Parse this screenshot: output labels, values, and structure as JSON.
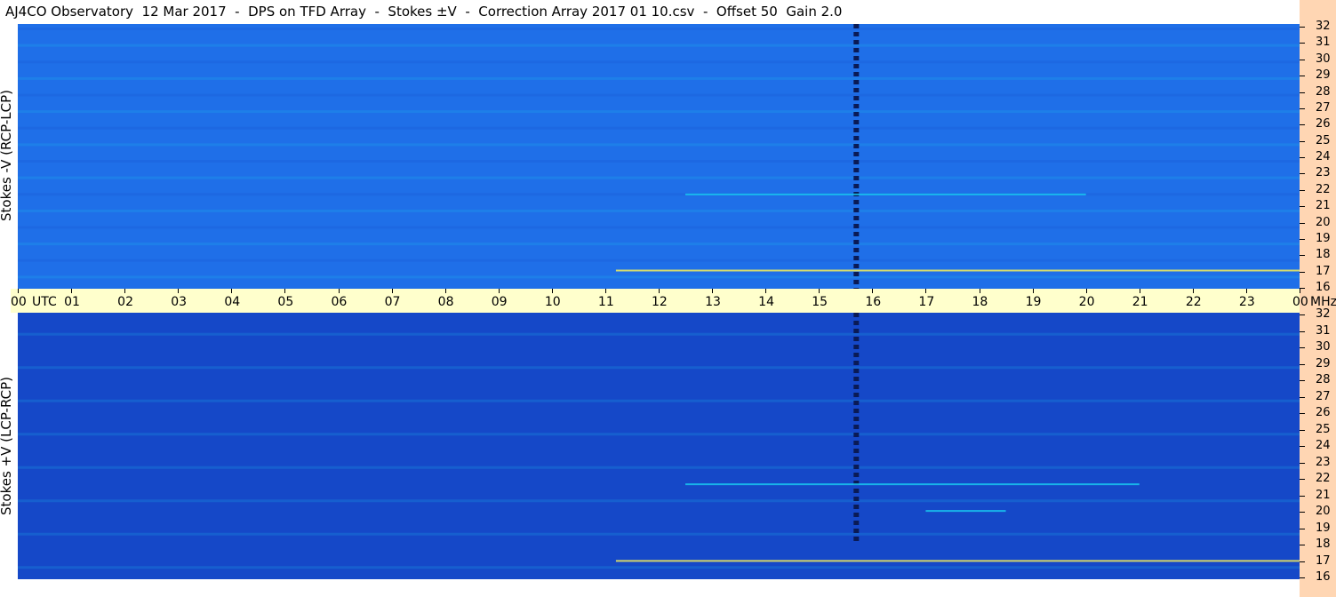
{
  "title": "AJ4CO Observatory  12 Mar 2017  -  DPS on TFD Array  -  Stokes ±V  -  Correction Array 2017 01 10.csv  -  Offset 50  Gain 2.0",
  "panels": {
    "top_label": "Stokes -V (RCP-LCP)",
    "bottom_label": "Stokes +V (LCP-RCP)"
  },
  "colors": {
    "background_blue": "#1f6fe8",
    "dark_blue": "#1548c8",
    "cyan": "#19c8f0",
    "yellow": "#f5f05a",
    "axis_bg": "#ffd6b3",
    "time_bar_bg": "#ffffcc"
  },
  "chart_data": {
    "type": "heatmap",
    "x_unit_labels": [
      "00",
      "UTC",
      "01",
      "02",
      "03",
      "04",
      "05",
      "06",
      "07",
      "08",
      "09",
      "10",
      "11",
      "12",
      "13",
      "14",
      "15",
      "16",
      "17",
      "18",
      "19",
      "20",
      "21",
      "22",
      "23",
      "00",
      "MHz"
    ],
    "time_ticks": [
      "00",
      "01",
      "02",
      "03",
      "04",
      "05",
      "06",
      "07",
      "08",
      "09",
      "10",
      "11",
      "12",
      "13",
      "14",
      "15",
      "16",
      "17",
      "18",
      "19",
      "20",
      "21",
      "22",
      "23",
      "00"
    ],
    "utc_label": "UTC",
    "freq_unit": "MHz",
    "freq_ticks": [
      "32",
      "31",
      "30",
      "29",
      "28",
      "27",
      "26",
      "25",
      "24",
      "23",
      "22",
      "21",
      "20",
      "19",
      "18",
      "17",
      "16"
    ],
    "x_range_hours": [
      0,
      24
    ],
    "y_range_mhz": [
      16,
      32
    ],
    "features": [
      {
        "panel": "top",
        "kind": "vertical_pulsed_line",
        "time_hours": 15.7,
        "freq_mhz": [
          16,
          32
        ]
      },
      {
        "panel": "bottom",
        "kind": "vertical_pulsed_line",
        "time_hours": 15.7,
        "freq_mhz": [
          18.2,
          32
        ]
      },
      {
        "panel": "top",
        "kind": "horizontal_interference",
        "freq_mhz": 17.1,
        "time_hours": [
          11.2,
          24
        ]
      },
      {
        "panel": "bottom",
        "kind": "horizontal_interference",
        "freq_mhz": 17.1,
        "time_hours": [
          11.2,
          24
        ]
      },
      {
        "panel": "top",
        "kind": "horizontal_interference",
        "freq_mhz": 21.7,
        "time_hours": [
          12.5,
          20
        ]
      },
      {
        "panel": "bottom",
        "kind": "horizontal_interference",
        "freq_mhz": 21.7,
        "time_hours": [
          12.5,
          21
        ]
      },
      {
        "panel": "bottom",
        "kind": "horizontal_interference",
        "freq_mhz": 20.1,
        "time_hours": [
          17,
          18.5
        ]
      }
    ]
  }
}
